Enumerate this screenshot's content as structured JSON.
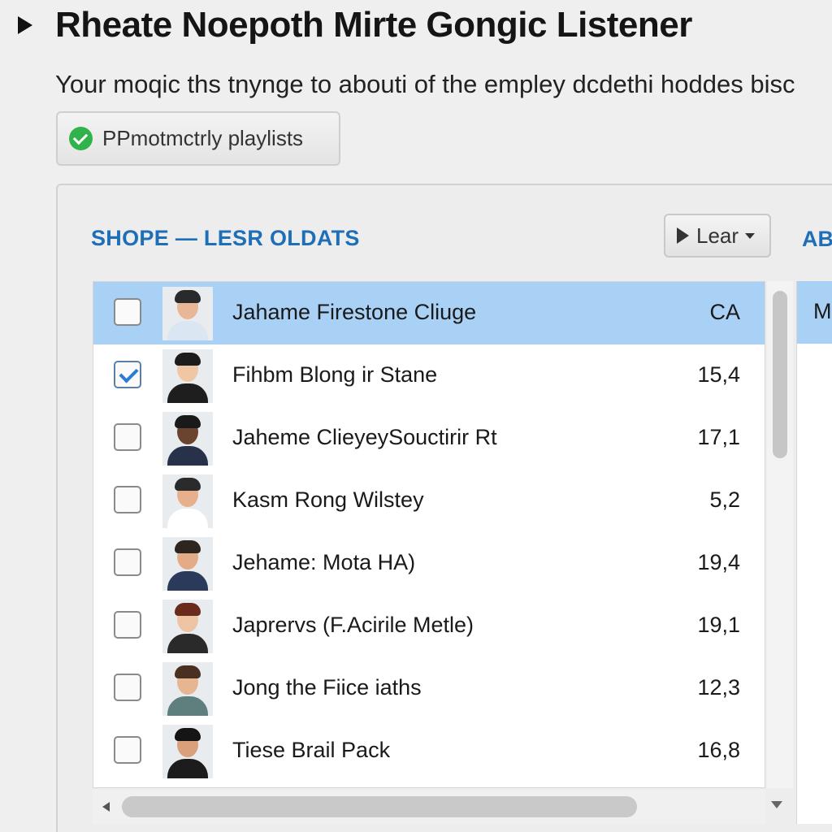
{
  "header": {
    "title": "Rheate Noepoth Mirte Gongic Listener",
    "description": "Your moqic ths tnynge to abouti of the empley dcdethi hoddes bisc",
    "status_button_label": "PPmotmctrly playlists"
  },
  "panel": {
    "heading": "SHOPE — LESR OLDATS",
    "sort_dropdown_label": "Lear",
    "right_column_header": "AB"
  },
  "rows": [
    {
      "name": "Jahame Firestone Cliuge",
      "value": "CA",
      "checked": false,
      "selected": true,
      "right": "M"
    },
    {
      "name": "Fihbm Blong ir Stane",
      "value": "15,4",
      "checked": true,
      "selected": false,
      "right": ""
    },
    {
      "name": "Jaheme ClieyeySouctirir Rt",
      "value": "17,1",
      "checked": false,
      "selected": false,
      "right": ""
    },
    {
      "name": "Kasm Rong Wilstey",
      "value": "5,2",
      "checked": false,
      "selected": false,
      "right": ""
    },
    {
      "name": "Jehame: Mota HA)",
      "value": "19,4",
      "checked": false,
      "selected": false,
      "right": ""
    },
    {
      "name": "Japrervs (F.Acirile Metle)",
      "value": "19,1",
      "checked": false,
      "selected": false,
      "right": ""
    },
    {
      "name": "Jong the Fiice iaths",
      "value": "12,3",
      "checked": false,
      "selected": false,
      "right": ""
    },
    {
      "name": "Tiese Brail Pack",
      "value": "16,8",
      "checked": false,
      "selected": false,
      "right": ""
    }
  ],
  "avatars": [
    {
      "skin": "#e8b896",
      "hair": "#2a2a2a",
      "shirt": "#dbe6f3"
    },
    {
      "skin": "#f0c7a4",
      "hair": "#1c1c1c",
      "shirt": "#1e1e1e"
    },
    {
      "skin": "#6b4430",
      "hair": "#1a1a1a",
      "shirt": "#27314a"
    },
    {
      "skin": "#e6b08c",
      "hair": "#2b2b2b",
      "shirt": "#ffffff"
    },
    {
      "skin": "#e4ac86",
      "hair": "#2d2620",
      "shirt": "#2b3a5a"
    },
    {
      "skin": "#efc4a4",
      "hair": "#6a2a1c",
      "shirt": "#2a2a2a"
    },
    {
      "skin": "#e6b592",
      "hair": "#4a3020",
      "shirt": "#5f7f7f"
    },
    {
      "skin": "#d9a07c",
      "hair": "#151515",
      "shirt": "#1c1c1c"
    }
  ],
  "colors": {
    "accent": "#1f6fb8",
    "selection": "#a9d0f5",
    "check_green": "#2fb34a",
    "checkbox_blue": "#2a7bd4"
  }
}
